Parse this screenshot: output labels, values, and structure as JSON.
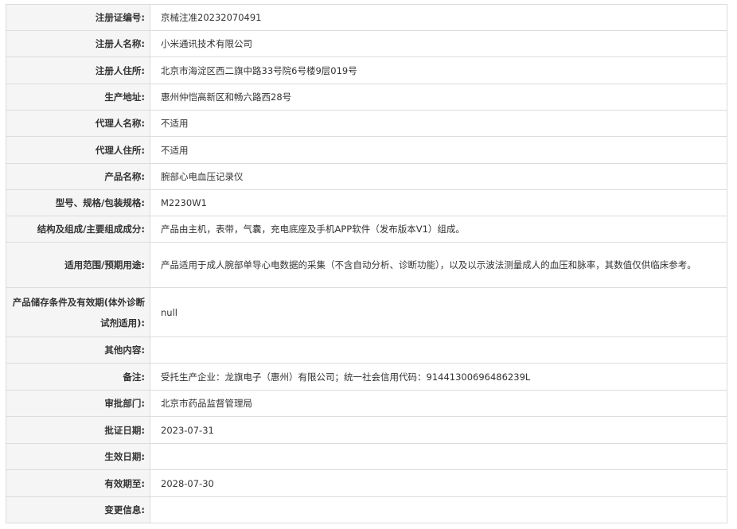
{
  "rows": [
    {
      "label": "注册证编号:",
      "value": "京械注准20232070491"
    },
    {
      "label": "注册人名称:",
      "value": "小米通讯技术有限公司"
    },
    {
      "label": "注册人住所:",
      "value": "北京市海淀区西二旗中路33号院6号楼9层019号"
    },
    {
      "label": "生产地址:",
      "value": "惠州仲恺高新区和畅六路西28号"
    },
    {
      "label": "代理人名称:",
      "value": "不适用"
    },
    {
      "label": "代理人住所:",
      "value": "不适用"
    },
    {
      "label": "产品名称:",
      "value": "腕部心电血压记录仪"
    },
    {
      "label": "型号、规格/包装规格:",
      "value": "M2230W1"
    },
    {
      "label": "结构及组成/主要组成成分:",
      "value": "产品由主机，表带，气囊，充电底座及手机APP软件（发布版本V1）组成。"
    },
    {
      "label": "适用范围/预期用途:",
      "value": "产品适用于成人腕部单导心电数据的采集（不含自动分析、诊断功能），以及以示波法测量成人的血压和脉率，其数值仅供临床参考。"
    },
    {
      "label": "产品储存条件及有效期(体外诊断试剂适用):",
      "value": "null"
    },
    {
      "label": "其他内容:",
      "value": ""
    },
    {
      "label": "备注:",
      "value": "受托生产企业：龙旗电子（惠州）有限公司；统一社会信用代码：91441300696486239L"
    },
    {
      "label": "审批部门:",
      "value": "北京市药品监督管理局"
    },
    {
      "label": "批证日期:",
      "value": "2023-07-31"
    },
    {
      "label": "生效日期:",
      "value": ""
    },
    {
      "label": "有效期至:",
      "value": "2028-07-30"
    },
    {
      "label": "变更信息:",
      "value": ""
    }
  ]
}
